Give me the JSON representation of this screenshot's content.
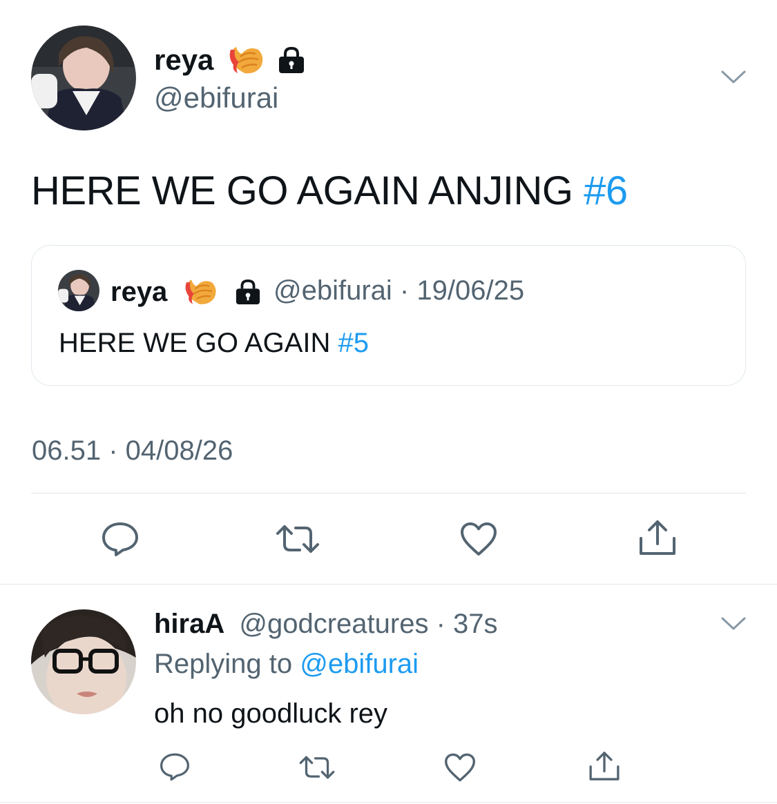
{
  "main_tweet": {
    "display_name": "reya",
    "handle": "@ebifurai",
    "text": "HERE WE GO AGAIN ANJING",
    "hashtag": "#6",
    "timestamp": "06.51 · 04/08/26",
    "icons": [
      "fried-shrimp-emoji",
      "lock-icon",
      "chevron-down-icon"
    ]
  },
  "quoted_tweet": {
    "display_name": "reya",
    "handle": "@ebifurai",
    "separator": "·",
    "date": "19/06/25",
    "text": "HERE WE GO AGAIN",
    "hashtag": "#5"
  },
  "actions": {
    "icons": [
      "reply-icon",
      "retweet-icon",
      "like-icon",
      "share-icon"
    ]
  },
  "reply": {
    "display_name": "hiraA",
    "handle": "@godcreatures",
    "separator": "·",
    "time": "37s",
    "replying_prefix": "Replying to",
    "replying_to": "@ebifurai",
    "text": "oh no goodluck rey"
  },
  "colors": {
    "link": "#1d9bf0",
    "muted": "#536471",
    "text": "#0f1419",
    "divider": "#e1e8ed"
  }
}
